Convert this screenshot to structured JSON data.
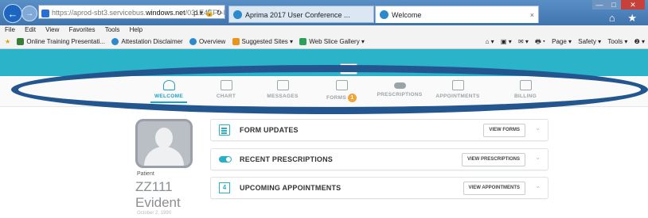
{
  "browser": {
    "address": {
      "prefix": "https://aprod-sbt3.servicebus.",
      "domain": "windows.net",
      "suffix": "/031E4EF0-D...",
      "tools": "ρ ▾ 🔒 ↻"
    },
    "tabs": [
      {
        "label": "Aprima 2017 User Conference ..."
      },
      {
        "label": "Welcome",
        "close": "×"
      }
    ],
    "window_controls": {
      "min": "—",
      "max": "□",
      "close": "✕"
    },
    "home_star": "⌂ ★",
    "menu": [
      "File",
      "Edit",
      "View",
      "Favorites",
      "Tools",
      "Help"
    ],
    "favorites": [
      "Online Training Presentati...",
      "Attestation Disclaimer",
      "Overview",
      "Suggested Sites ▾",
      "Web Slice Gallery ▾"
    ],
    "commands": [
      "⌂ ▾",
      "▣ ▾",
      "✉ ▾",
      "🖶 ▾",
      "Page ▾",
      "Safety ▾",
      "Tools ▾",
      "❷ ▾"
    ]
  },
  "app": {
    "collapse_handle": "⌃",
    "nav": [
      {
        "label": "WELCOME",
        "active": true
      },
      {
        "label": "CHART"
      },
      {
        "label": "MESSAGES"
      },
      {
        "label": "FORMS",
        "badge": "1"
      },
      {
        "label": "PRESCRIPTIONS"
      },
      {
        "label": "APPOINTMENTS"
      },
      {
        "label": "BILLING"
      }
    ],
    "patient": {
      "label": "Patient",
      "first": "ZZ111",
      "last": "Evident",
      "dob": "October 2, 1990"
    },
    "cards": [
      {
        "title": "FORM UPDATES",
        "button": "VIEW FORMS",
        "icon": "form-icon"
      },
      {
        "title": "RECENT PRESCRIPTIONS",
        "button": "VIEW PRESCRIPTIONS",
        "icon": "prescription-toggle-icon"
      },
      {
        "title": "UPCOMING APPOINTMENTS",
        "button": "VIEW APPOINTMENTS",
        "icon": "calendar-icon",
        "icon_text": "4"
      }
    ],
    "chevron": "⌄"
  }
}
